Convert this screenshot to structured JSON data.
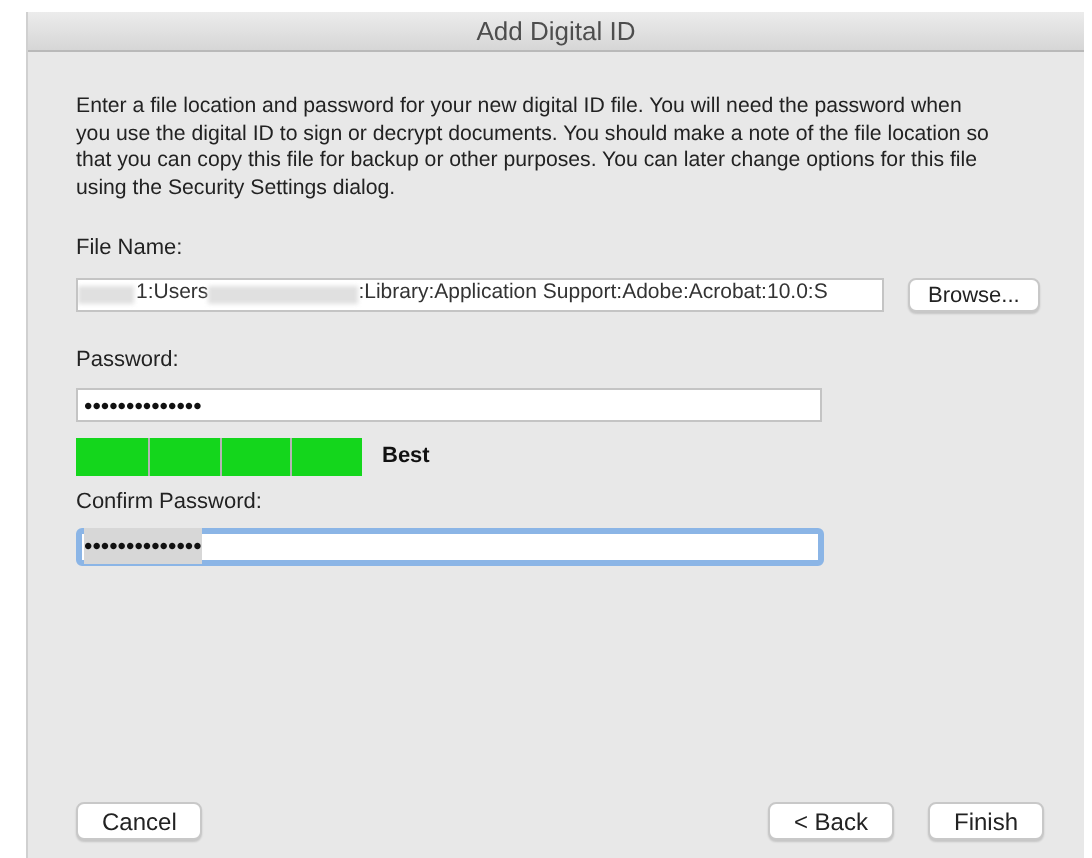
{
  "window": {
    "title": "Add Digital ID"
  },
  "intro": "Enter a file location and password for your new digital ID file. You will need the password when you use the digital ID to sign or decrypt documents. You should make a note of the file location so that you can copy this file for backup or other purposes. You can later change options for this file using the Security Settings dialog.",
  "file_name": {
    "label": "File Name:",
    "value_parts": [
      "1:Users",
      ":Library:Application Support:Adobe:Acrobat:10.0:S"
    ],
    "browse": "Browse..."
  },
  "password": {
    "label": "Password:",
    "value": "••••••••••••••",
    "level": 1,
    "strength": "Best"
  },
  "confirm": {
    "label": "Confirm Password:",
    "value": "••••••••••••••",
    "focused": true
  },
  "buttons": [
    {
      "label": "Cancel",
      "kind": "left"
    },
    {
      "label": "< Back",
      "kind": "right"
    },
    {
      "label": "Finish",
      "kind": "right"
    }
  ]
}
